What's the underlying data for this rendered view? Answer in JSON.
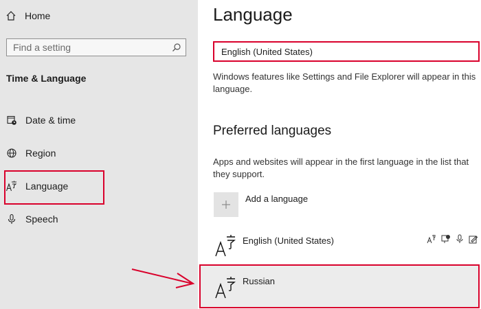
{
  "sidebar": {
    "home_label": "Home",
    "search_placeholder": "Find a setting",
    "section_title": "Time & Language",
    "items": [
      {
        "label": "Date & time",
        "icon": "calendar-clock-icon"
      },
      {
        "label": "Region",
        "icon": "globe-icon"
      },
      {
        "label": "Language",
        "icon": "language-icon"
      },
      {
        "label": "Speech",
        "icon": "microphone-icon"
      }
    ]
  },
  "main": {
    "title": "Language",
    "display_language": "English (United States)",
    "display_language_desc": "Windows features like Settings and File Explorer will appear in this language.",
    "preferred_title": "Preferred languages",
    "preferred_desc": "Apps and websites will appear in the first language in the list that they support.",
    "add_language_label": "Add a language",
    "languages": [
      {
        "name": "English (United States)"
      },
      {
        "name": "Russian"
      }
    ]
  },
  "colors": {
    "highlight": "#d9002b",
    "sidebar_bg": "#e6e6e6"
  }
}
